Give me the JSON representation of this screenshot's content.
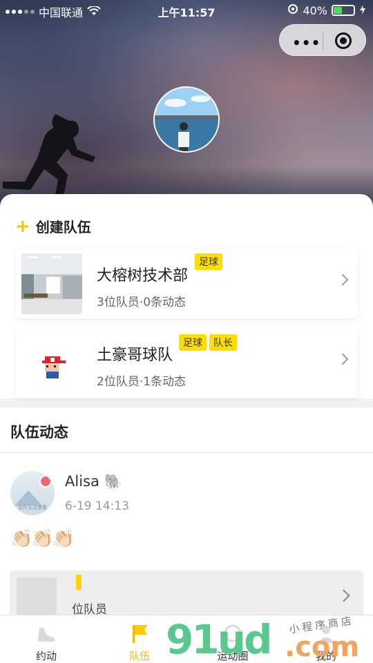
{
  "status_bar": {
    "carrier": "中国联通",
    "time": "上午11:57",
    "battery": "40%"
  },
  "header": {
    "capsule_menu_icon": "more-dots-icon",
    "capsule_close_icon": "target-circle-icon"
  },
  "create": {
    "label": "创建队伍"
  },
  "teams": [
    {
      "name": "大榕树技术部",
      "tags": [
        "足球"
      ],
      "meta": "3位队员·0条动态"
    },
    {
      "name": "土豪哥球队",
      "tags": [
        "足球",
        "队长"
      ],
      "meta": "2位队员·1条动态"
    }
  ],
  "feed": {
    "title": "队伍动态",
    "post": {
      "user": "Alisa 🐘",
      "time": "6-19 14:13",
      "avatar_caption": "暂时无法查看",
      "text": "👏🏻👏🏻👏🏻",
      "share_text": "位队员"
    }
  },
  "tabbar": {
    "items": [
      {
        "label": "约动",
        "icon": "sneaker-icon"
      },
      {
        "label": "队伍",
        "icon": "flag-icon"
      },
      {
        "label": "运动圈",
        "icon": "circle-icon"
      },
      {
        "label": "我的",
        "icon": "user-icon"
      }
    ]
  },
  "watermark": {
    "brand": "91ud",
    "domain": ".com",
    "shop": "小程序商店"
  },
  "colors": {
    "accent": "#ffdd00",
    "active_tab": "#f5b800"
  }
}
